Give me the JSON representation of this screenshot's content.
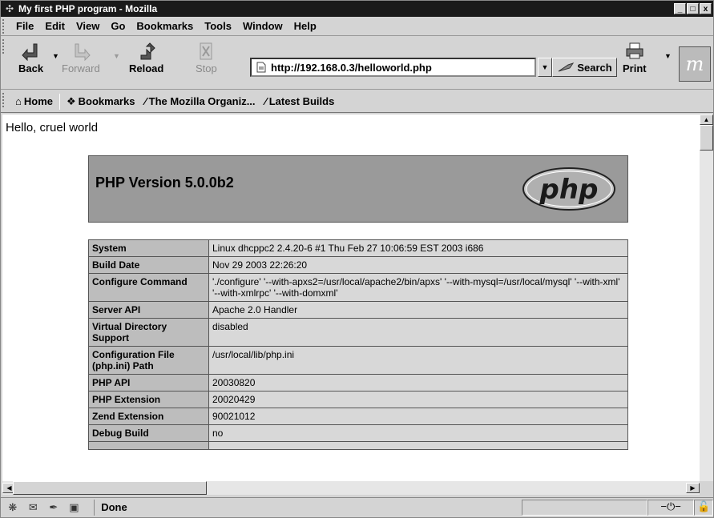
{
  "window": {
    "title": "My first PHP program - Mozilla",
    "controls": [
      "_",
      "□",
      "x"
    ]
  },
  "menu": [
    "File",
    "Edit",
    "View",
    "Go",
    "Bookmarks",
    "Tools",
    "Window",
    "Help"
  ],
  "nav": {
    "back": "Back",
    "forward": "Forward",
    "reload": "Reload",
    "stop": "Stop",
    "url": "http://192.168.0.3/helloworld.php",
    "search": "Search",
    "print": "Print"
  },
  "personal": {
    "home": "Home",
    "bookmarks": "Bookmarks",
    "mozilla_org": "The Mozilla Organiz...",
    "latest_builds": "Latest Builds"
  },
  "page": {
    "greeting": "Hello, cruel world",
    "php_version": "PHP Version 5.0.0b2",
    "php_logo_text": "php",
    "rows": [
      {
        "key": "System",
        "value": "Linux dhcppc2 2.4.20-6 #1 Thu Feb 27 10:06:59 EST 2003 i686"
      },
      {
        "key": "Build Date",
        "value": "Nov 29 2003 22:26:20"
      },
      {
        "key": "Configure Command",
        "value": "'./configure' '--with-apxs2=/usr/local/apache2/bin/apxs' '--with-mysql=/usr/local/mysql' '--with-xml' '--with-xmlrpc' '--with-domxml'"
      },
      {
        "key": "Server API",
        "value": "Apache 2.0 Handler"
      },
      {
        "key": "Virtual Directory Support",
        "value": "disabled"
      },
      {
        "key": "Configuration File (php.ini) Path",
        "value": "/usr/local/lib/php.ini"
      },
      {
        "key": "PHP API",
        "value": "20030820"
      },
      {
        "key": "PHP Extension",
        "value": "20020429"
      },
      {
        "key": "Zend Extension",
        "value": "90021012"
      },
      {
        "key": "Debug Build",
        "value": "no"
      },
      {
        "key": "",
        "value": ""
      }
    ]
  },
  "status": {
    "text": "Done"
  },
  "colors": {
    "titlebar": "#1a1a1a",
    "chrome": "#d4d4d4",
    "php_header": "#9a9a9a",
    "table_key": "#bdbdbd",
    "table_value": "#d8d8d8"
  }
}
